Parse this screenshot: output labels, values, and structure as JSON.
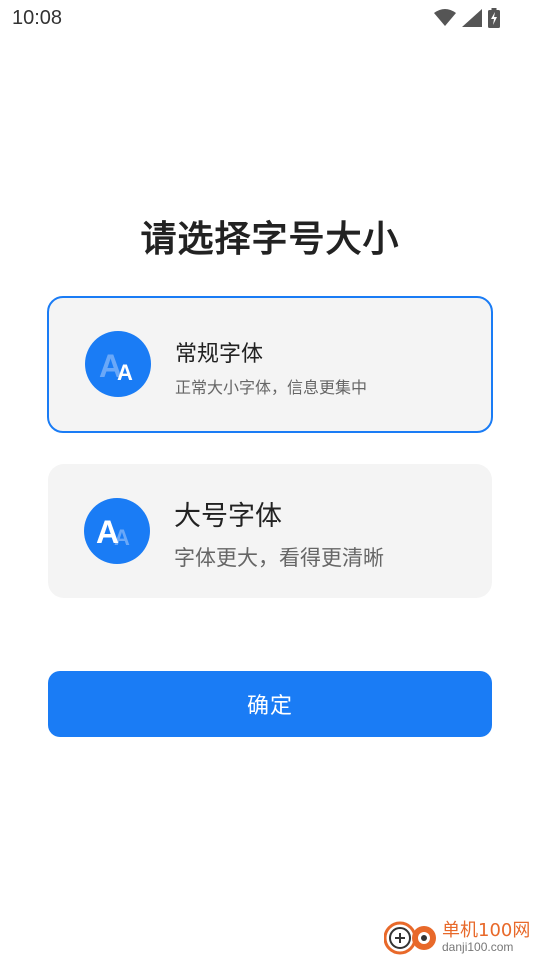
{
  "status_bar": {
    "time": "10:08",
    "icons": [
      "wifi-icon",
      "signal-icon",
      "battery-charging-icon"
    ]
  },
  "title": "请选择字号大小",
  "options": [
    {
      "title": "常规字体",
      "description": "正常大小字体，信息更集中",
      "selected": true,
      "icon": "font-size-normal-icon"
    },
    {
      "title": "大号字体",
      "description": "字体更大，看得更清晰",
      "selected": false,
      "icon": "font-size-large-icon"
    }
  ],
  "confirm_label": "确定",
  "watermark": {
    "name": "单机100网",
    "domain": "danji100.com"
  },
  "colors": {
    "accent": "#1a7cf5",
    "card_background": "#f4f4f4",
    "watermark_orange": "#e8692a"
  }
}
